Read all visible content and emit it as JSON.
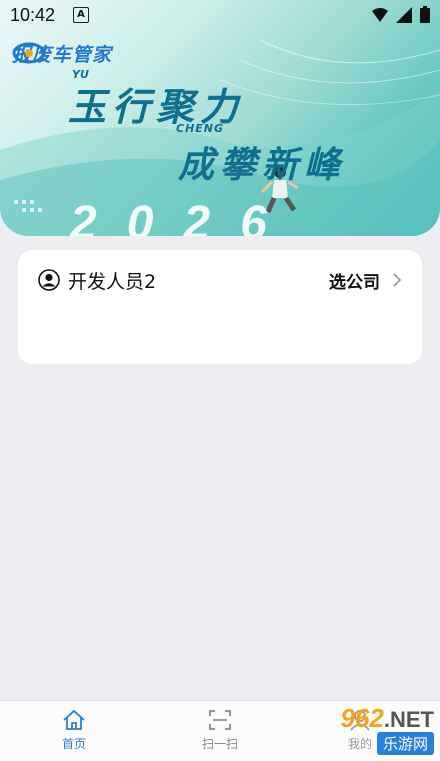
{
  "status_bar": {
    "time": "10:42",
    "notification_letter": "A"
  },
  "banner": {
    "brand": "报废车管家",
    "line1": "玉行聚力",
    "line1_sub": "YU",
    "line2": "成攀新峰",
    "line2_sub": "CHENG",
    "year": "2026"
  },
  "card": {
    "user_name": "开发人员2",
    "company_label": "选公司"
  },
  "tabbar": {
    "home": "首页",
    "scan": "扫一扫",
    "mine": "我的"
  },
  "watermark": {
    "num": "962",
    "net": ".NET",
    "cn": "乐游网"
  },
  "colors": {
    "accent": "#2f7ae0",
    "banner_teal": "#3fb3b9",
    "headline": "#0e6f8e"
  }
}
